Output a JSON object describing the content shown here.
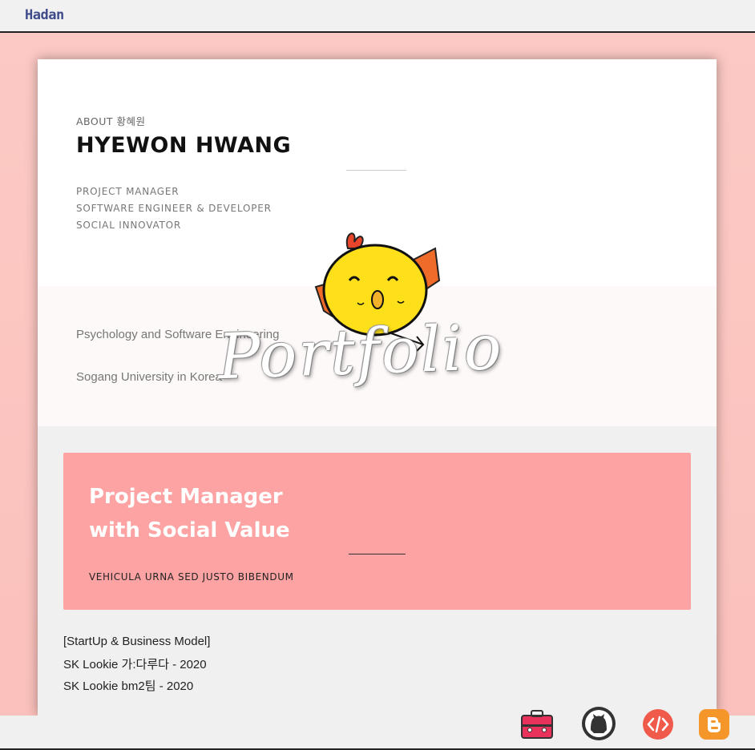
{
  "header": {
    "logo": "Hadan"
  },
  "about": {
    "label": "ABOUT 황혜원",
    "name": "HYEWON HWANG",
    "roles": [
      "PROJECT MANAGER",
      "SOFTWARE ENGINEER & DEVELOPER",
      "SOCIAL INNOVATOR"
    ]
  },
  "education": {
    "major": "Psychology and Software Engineering",
    "school": "Sogang University in Korea"
  },
  "highlight": {
    "title_line1": "Project Manager",
    "title_line2": "with Social Value",
    "subtitle": "VEHICULA URNA SED JUSTO BIBENDUM"
  },
  "projects": {
    "heading": "[StartUp & Business Model]",
    "items": [
      "SK Lookie 가:다루다 - 2020",
      "SK Lookie bm2팀 - 2020"
    ]
  },
  "overlay": {
    "text": "Portfolio"
  },
  "dock": {
    "icons": [
      "toolbox-icon",
      "github-icon",
      "code-icon",
      "blogger-icon"
    ],
    "colors": {
      "toolbox": "#e8315b",
      "github": "#333333",
      "code": "#f05a4a",
      "blogger": "#f5962a"
    }
  },
  "colors": {
    "stage_bg": "#fcc9c4",
    "panel": "#fea3a3",
    "logo": "#3f4a8a"
  }
}
